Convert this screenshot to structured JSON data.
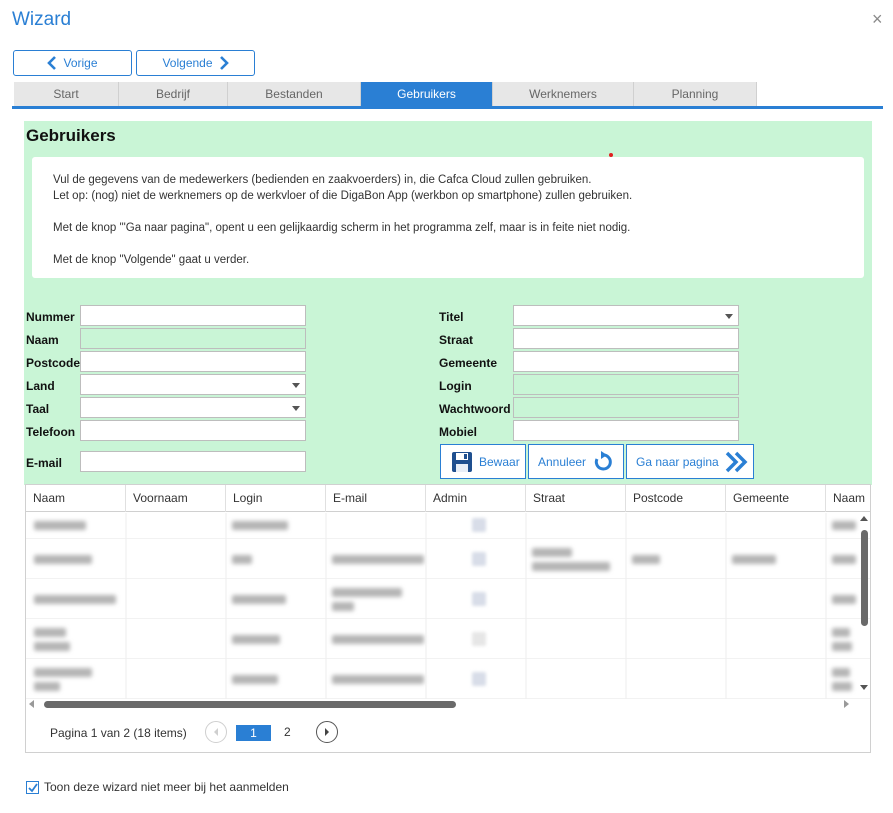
{
  "window": {
    "title": "Wizard",
    "close_glyph": "×"
  },
  "nav": {
    "prev_label": "Vorige",
    "next_label": "Volgende"
  },
  "tabs": [
    {
      "label": "Start",
      "active": false
    },
    {
      "label": "Bedrijf",
      "active": false
    },
    {
      "label": "Bestanden",
      "active": false
    },
    {
      "label": "Gebruikers",
      "active": true
    },
    {
      "label": "Werknemers",
      "active": false
    },
    {
      "label": "Planning",
      "active": false
    }
  ],
  "panel": {
    "title": "Gebruikers",
    "info": [
      "Vul de gegevens van de medewerkers (bedienden en zaakvoerders) in, die Cafca Cloud zullen gebruiken.",
      "Let op: (nog) niet de werknemers op de werkvloer of die DigaBon App (werkbon op smartphone) zullen gebruiken.",
      "Met de knop '\"Ga naar pagina\", opent u een gelijkaardig scherm in het programma zelf, maar is in feite niet nodig.",
      "Met de knop \"Volgende\" gaat u verder."
    ]
  },
  "form": {
    "left": {
      "nummer": "Nummer",
      "naam": "Naam",
      "postcode": "Postcode",
      "land": "Land",
      "taal": "Taal",
      "telefoon": "Telefoon",
      "email": "E-mail"
    },
    "right": {
      "titel": "Titel",
      "straat": "Straat",
      "gemeente": "Gemeente",
      "login": "Login",
      "wachtwoord": "Wachtwoord",
      "mobiel": "Mobiel"
    },
    "values": {
      "nummer": "",
      "naam": "",
      "postcode": "",
      "land": "",
      "taal": "",
      "telefoon": "",
      "email": "",
      "titel": "",
      "straat": "",
      "gemeente": "",
      "login": "",
      "wachtwoord": "",
      "mobiel": ""
    }
  },
  "actions": {
    "save": "Bewaar",
    "cancel": "Annuleer",
    "goto": "Ga naar pagina"
  },
  "grid": {
    "columns": [
      "Naam",
      "Voornaam",
      "Login",
      "E-mail",
      "Admin",
      "Straat",
      "Postcode",
      "Gemeente",
      "Naam"
    ]
  },
  "pager": {
    "text": "Pagina 1 van 2 (18 items)",
    "current": "1",
    "next": "2"
  },
  "footer": {
    "checkbox_label": "Toon deze wizard niet meer bij het aanmelden",
    "checked": true
  },
  "colors": {
    "accent": "#2a7fd4",
    "panel_green": "#c9f5d6"
  },
  "icons": {
    "prev": "chevron-left-icon",
    "next": "chevron-right-icon",
    "save": "floppy-disk-icon",
    "cancel": "undo-arrow-icon",
    "goto": "double-chevron-right-icon",
    "close": "close-icon"
  }
}
